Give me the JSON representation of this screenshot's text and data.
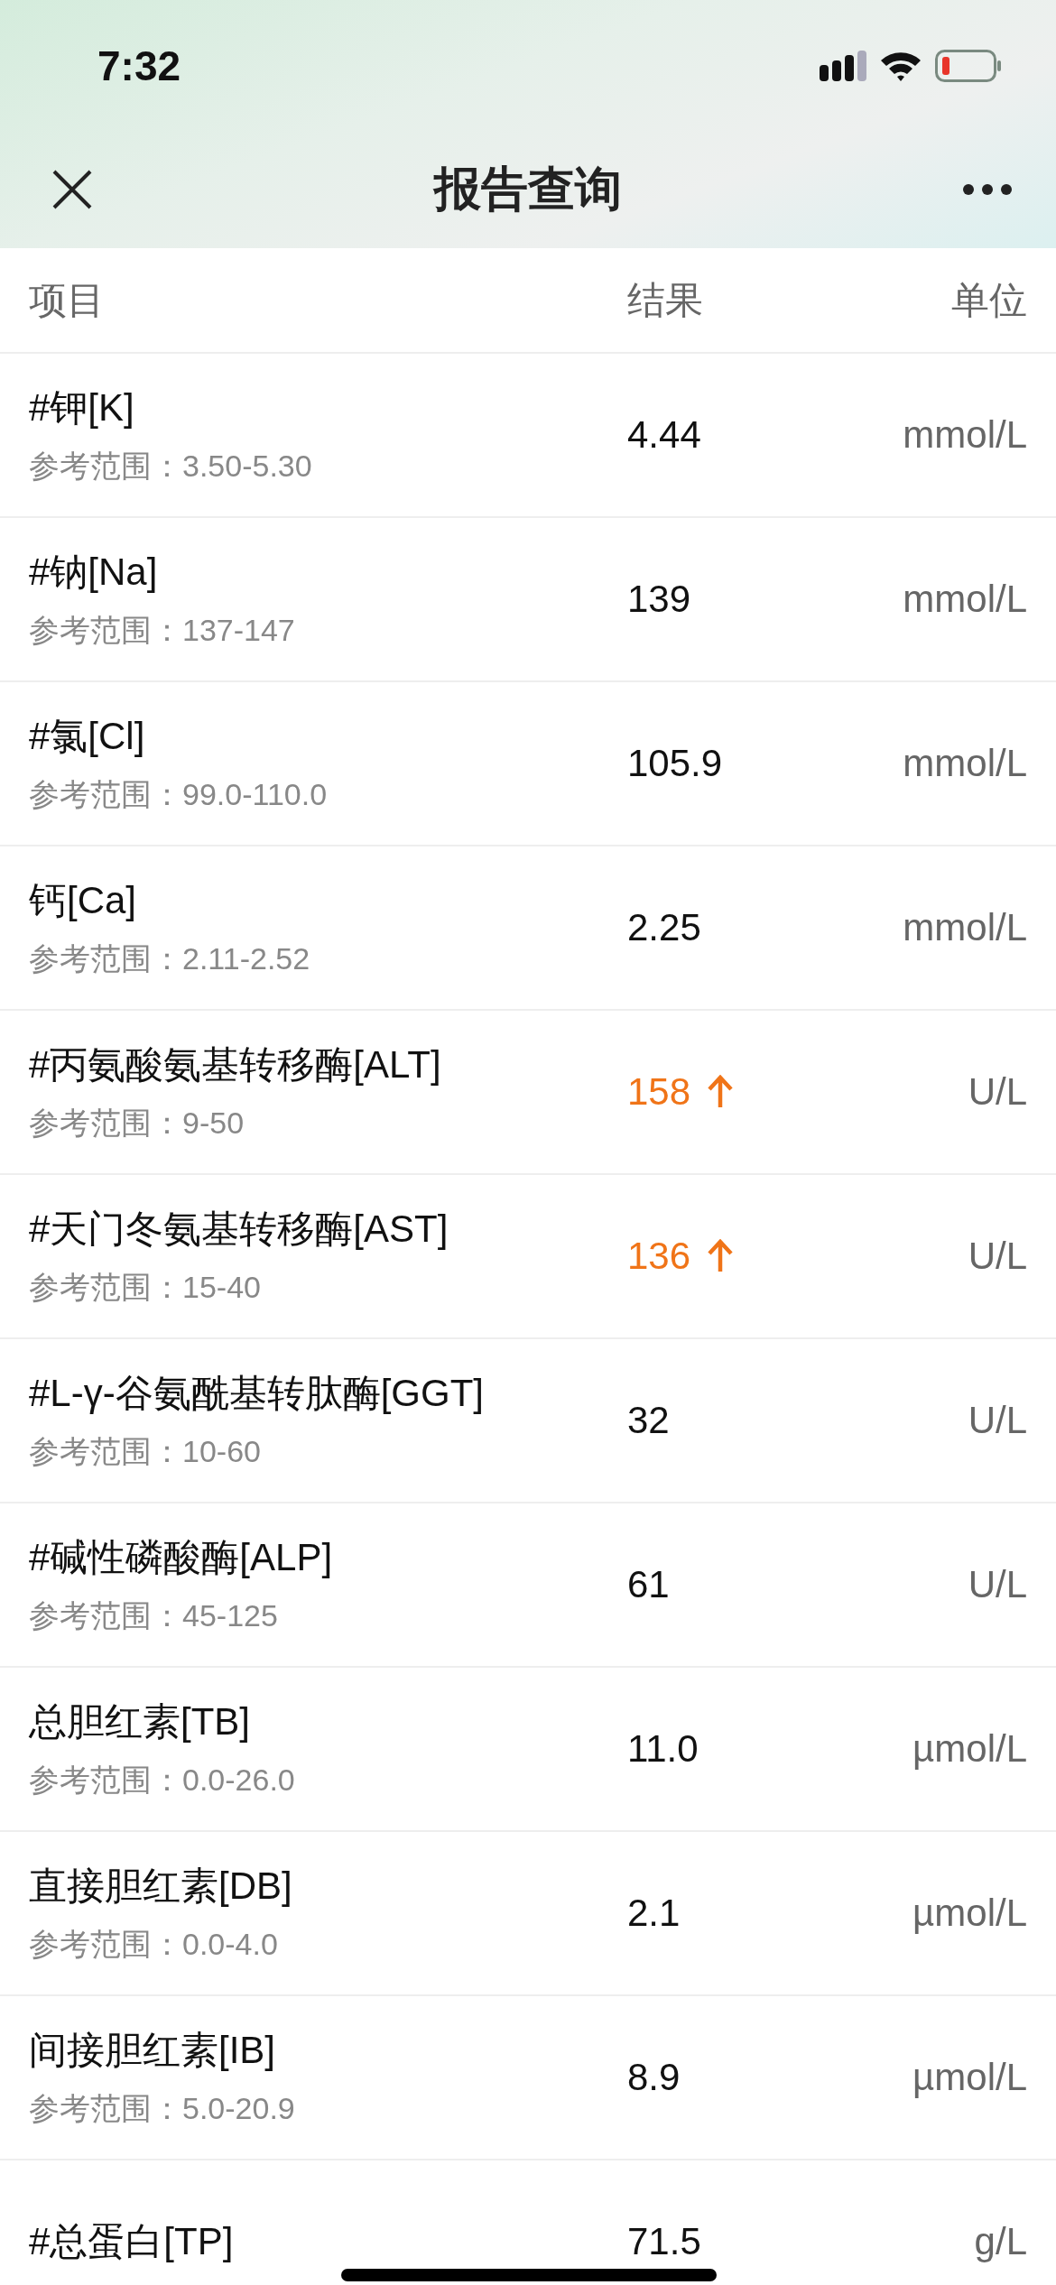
{
  "status_bar": {
    "time": "7:32"
  },
  "nav": {
    "title": "报告查询"
  },
  "table": {
    "columns": [
      "项目",
      "结果",
      "单位"
    ],
    "rows": [
      {
        "name": "#钾[K]",
        "reference": "参考范围：3.50-5.30",
        "result": "4.44",
        "high": false,
        "unit": "mmol/L"
      },
      {
        "name": "#钠[Na]",
        "reference": "参考范围：137-147",
        "result": "139",
        "high": false,
        "unit": "mmol/L"
      },
      {
        "name": "#氯[Cl]",
        "reference": "参考范围：99.0-110.0",
        "result": "105.9",
        "high": false,
        "unit": "mmol/L"
      },
      {
        "name": "钙[Ca]",
        "reference": "参考范围：2.11-2.52",
        "result": "2.25",
        "high": false,
        "unit": "mmol/L"
      },
      {
        "name": "#丙氨酸氨基转移酶[ALT]",
        "reference": "参考范围：9-50",
        "result": "158",
        "high": true,
        "unit": "U/L"
      },
      {
        "name": "#天门冬氨基转移酶[AST]",
        "reference": "参考范围：15-40",
        "result": "136",
        "high": true,
        "unit": "U/L"
      },
      {
        "name": "#L-γ-谷氨酰基转肽酶[GGT]",
        "reference": "参考范围：10-60",
        "result": "32",
        "high": false,
        "unit": "U/L"
      },
      {
        "name": "#碱性磷酸酶[ALP]",
        "reference": "参考范围：45-125",
        "result": "61",
        "high": false,
        "unit": "U/L"
      },
      {
        "name": "总胆红素[TB]",
        "reference": "参考范围：0.0-26.0",
        "result": "11.0",
        "high": false,
        "unit": "µmol/L"
      },
      {
        "name": "直接胆红素[DB]",
        "reference": "参考范围：0.0-4.0",
        "result": "2.1",
        "high": false,
        "unit": "µmol/L"
      },
      {
        "name": "间接胆红素[IB]",
        "reference": "参考范围：5.0-20.9",
        "result": "8.9",
        "high": false,
        "unit": "µmol/L"
      },
      {
        "name": "#总蛋白[TP]",
        "result": "71.5",
        "high": false,
        "unit": "g/L"
      }
    ]
  }
}
